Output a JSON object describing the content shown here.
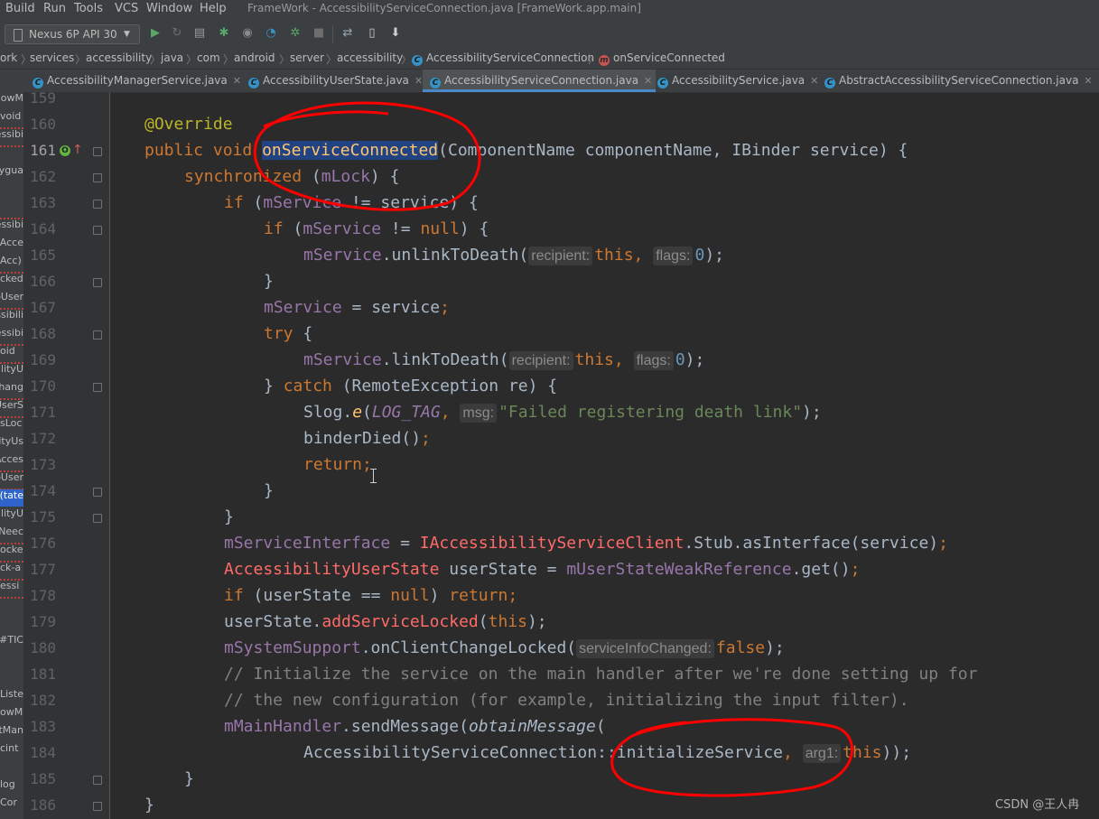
{
  "menu": {
    "items": [
      "Build",
      "Run",
      "Tools",
      "VCS",
      "Window",
      "Help"
    ],
    "window_title": "FrameWork - AccessibilityServiceConnection.java [FrameWork.app.main]"
  },
  "toolbar": {
    "device": "Nexus 6P API 30",
    "icons": [
      "run-icon",
      "rerun-icon",
      "coverage-icon",
      "debug-icon",
      "profile-icon",
      "profiler-icon",
      "attach-debugger-icon",
      "stop-icon",
      "sync-icon",
      "avd-manager-icon",
      "sdk-manager-icon"
    ]
  },
  "breadcrumbs": [
    "ork",
    "services",
    "accessibility",
    "java",
    "com",
    "android",
    "server",
    "accessibility",
    "AccessibilityServiceConnection",
    "onServiceConnected"
  ],
  "tabs": [
    {
      "label": "AccessibilityManagerService.java",
      "active": false
    },
    {
      "label": "AccessibilityUserState.java",
      "active": false
    },
    {
      "label": "AccessibilityServiceConnection.java",
      "active": true
    },
    {
      "label": "AccessibilityService.java",
      "active": false
    },
    {
      "label": "AbstractAccessibilityServiceConnection.java",
      "active": false
    }
  ],
  "project_panel": [
    "dowM",
    "void",
    "essibi",
    "",
    "ygua",
    "",
    "",
    "essibi",
    "Acce",
    "(Acc",
    "cked",
    "oUser",
    "ssibili",
    "essibi",
    "oid",
    "ilityU",
    "Chang",
    "UserS",
    "sLoc",
    "ityUs",
    "Acces",
    "oUser",
    "tate):",
    "ilityU",
    "Neec",
    "ocke",
    "ck-a",
    "essi",
    "",
    "",
    "TIC#",
    "",
    "",
    "Liste",
    "owM",
    "tMan",
    "cint",
    "",
    "log",
    "Cor"
  ],
  "line_numbers": [
    "159",
    "160",
    "161",
    "162",
    "163",
    "164",
    "165",
    "166",
    "167",
    "168",
    "169",
    "170",
    "171",
    "172",
    "173",
    "174",
    "175",
    "176",
    "177",
    "178",
    "179",
    "180",
    "181",
    "182",
    "183",
    "184",
    "185",
    "186"
  ],
  "code": {
    "l160_annotation": "@Override",
    "l161_public": "public",
    "l161_void": "void",
    "l161_name": "onServiceConnected",
    "l161_rest": "(ComponentName componentName, IBinder service) {",
    "l162_kw": "synchronized",
    "l162_open": " (",
    "l162_field": "mLock",
    "l162_close": ") {",
    "l163_kw": "if",
    "l163_open": " (",
    "l163_field": "mService",
    "l163_rest": " != service) {",
    "l164_kw": "if",
    "l164_open": " (",
    "l164_field": "mService",
    "l164_ne": " != ",
    "l164_null": "null",
    "l164_close": ") {",
    "l165_field": "mService",
    "l165_call": ".unlinkToDeath(",
    "l165_hint1": "recipient:",
    "l165_this": "this",
    "l165_comma": ", ",
    "l165_hint2": "flags:",
    "l165_zero": "0",
    "l165_end": ");",
    "l166_brace": "}",
    "l167_field": "mService",
    "l167_rest": " = service",
    "l167_semi": ";",
    "l168_kw": "try",
    "l168_brace": " {",
    "l169_field": "mService",
    "l169_call": ".linkToDeath(",
    "l169_hint1": "recipient:",
    "l169_this": "this",
    "l169_comma": ", ",
    "l169_hint2": "flags:",
    "l169_zero": "0",
    "l169_end": ");",
    "l170_brace": "} ",
    "l170_kw": "catch",
    "l170_rest": " (RemoteException re) {",
    "l171_cls": "Slog.",
    "l171_e": "e",
    "l171_open": "(",
    "l171_tag": "LOG_TAG",
    "l171_comma": ", ",
    "l171_hint": "msg:",
    "l171_str": "\"Failed registering death link\"",
    "l171_end": ");",
    "l172_call": "binderDied()",
    "l172_semi": ";",
    "l173_kw": "return",
    "l173_semi": ";",
    "l174_brace": "}",
    "l175_brace": "}",
    "l176_field": "mServiceInterface",
    "l176_eq": " = ",
    "l176_cls": "IAccessibilityServiceClient",
    "l176_rest": ".Stub.asInterface(service)",
    "l176_semi": ";",
    "l177_cls": "AccessibilityUserState",
    "l177_var": " userState = ",
    "l177_field": "mUserStateWeakReference",
    "l177_rest": ".get()",
    "l177_semi": ";",
    "l178_kw": "if",
    "l178_mid": " (userState == ",
    "l178_null": "null",
    "l178_close": ") ",
    "l178_ret": "return",
    "l178_semi": ";",
    "l179_var": "userState.",
    "l179_method": "addServiceLocked",
    "l179_open": "(",
    "l179_this": "this",
    "l179_end": ");",
    "l180_field": "mSystemSupport",
    "l180_call": ".onClientChangeLocked(",
    "l180_hint": "serviceInfoChanged:",
    "l180_false": "false",
    "l180_end": ");",
    "l181_comment": "// Initialize the service on the main handler after we're done setting up for",
    "l182_comment": "// the new configuration (for example, initializing the input filter).",
    "l183_field": "mMainHandler",
    "l183_call": ".sendMessage(",
    "l183_om": "obtainMessage",
    "l183_open": "(",
    "l184_ref": "AccessibilityServiceConnection::initializeService",
    "l184_comma": ", ",
    "l184_hint": "arg1:",
    "l184_this": "this",
    "l184_end": "));",
    "l185_brace": "}",
    "l186_brace": "}"
  },
  "watermark": "CSDN @王人冉",
  "colors": {
    "editor_bg": "#2b2b2b",
    "keyword": "#cc7832",
    "annotation": "#bbb529",
    "field": "#9876aa",
    "method_decl": "#ffc66d",
    "string": "#6a8759",
    "number": "#6897bb",
    "comment": "#808080",
    "highlight_markup": "#ff0000"
  }
}
